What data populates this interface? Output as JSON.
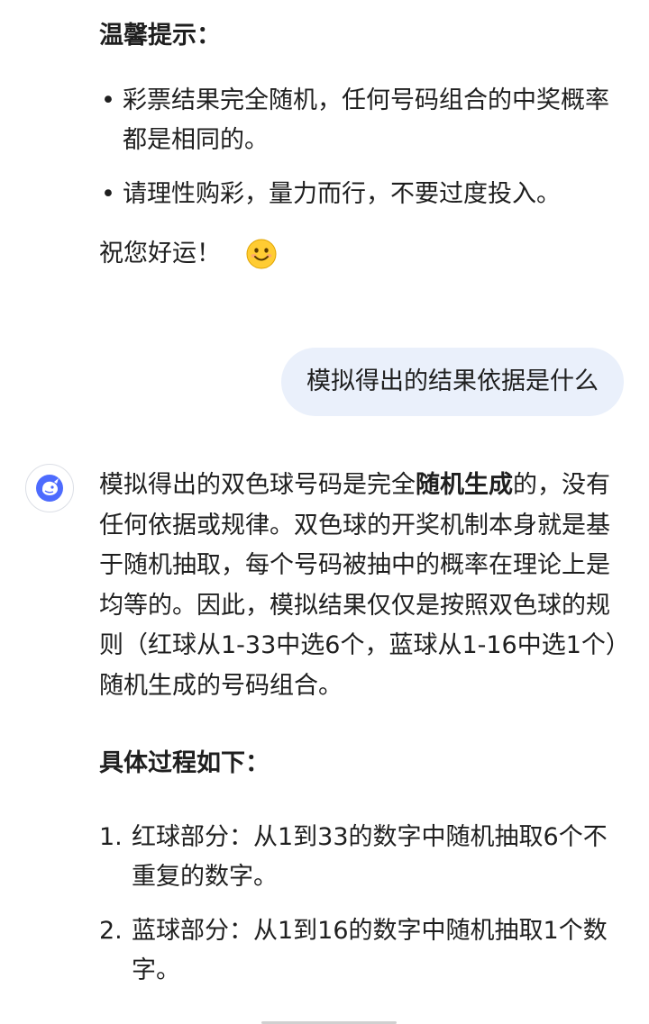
{
  "previous_message": {
    "heading": "温馨提示：",
    "bullets": [
      "彩票结果完全随机，任何号码组合的中奖概率都是相同的。",
      "请理性购彩，量力而行，不要过度投入。"
    ],
    "closing": "祝您好运！",
    "closing_emoji": "smiling-face-icon"
  },
  "user_message": {
    "text": "模拟得出的结果依据是什么"
  },
  "assistant_reply": {
    "avatar_icon": "deepseek-whale-icon",
    "intro_before_bold": "模拟得出的双色球号码是完全",
    "intro_bold": "随机生成",
    "intro_after_bold": "的，没有任何依据或规律。双色球的开奖机制本身就是基于随机抽取，每个号码被抽中的概率在理论上是均等的。因此，模拟结果仅仅是按照双色球的规则（红球从1-33中选6个，蓝球从1-16中选1个）随机生成的号码组合。",
    "process_heading": "具体过程如下：",
    "steps": [
      {
        "number": "1.",
        "text": "红球部分：从1到33的数字中随机抽取6个不重复的数字。"
      },
      {
        "number": "2.",
        "text": "蓝球部分：从1到16的数字中随机抽取1个数字。"
      }
    ]
  },
  "colors": {
    "user_bubble_bg": "#eaf0fb",
    "avatar_blue": "#4d6bfe",
    "text": "#1f1f1f"
  }
}
